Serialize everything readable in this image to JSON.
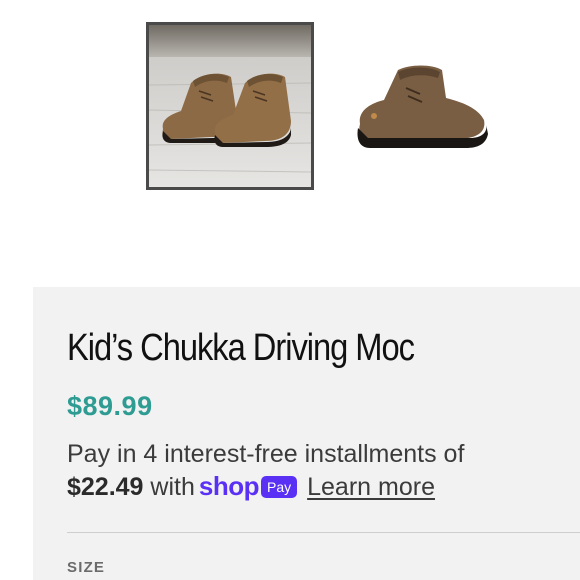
{
  "gallery": {
    "images": [
      {
        "alt": "pair of brown chukka driving mocs on wood floor",
        "selected": true
      },
      {
        "alt": "single brown chukka driving moc side view",
        "selected": false
      }
    ]
  },
  "product": {
    "title": "Kid’s Chukka Driving Moc",
    "price": "$89.99"
  },
  "installments": {
    "text_1": "Pay in 4 interest-free installments of",
    "amount": "$22.49",
    "with": "with",
    "shop_word": "shop",
    "pay_badge": "Pay",
    "learn_more": "Learn more"
  },
  "options": {
    "size_label": "SIZE"
  },
  "colors": {
    "price": "#2f9c93",
    "shop_pay": "#5a31f4",
    "panel_bg": "#f2f2f2"
  }
}
